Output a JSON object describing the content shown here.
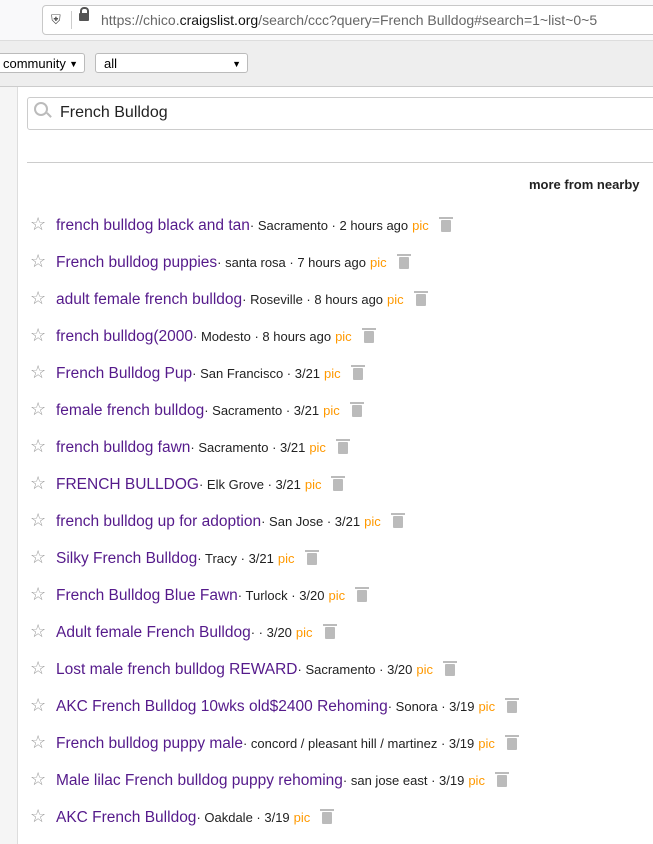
{
  "browser": {
    "url_prefix": "https://chico.",
    "url_domain": "craigslist.org",
    "url_suffix": "/search/ccc?query=French Bulldog#search=1~list~0~5"
  },
  "filters": {
    "category": "community",
    "subcategory": "all"
  },
  "search": {
    "query": "French Bulldog"
  },
  "nearby_label": "more from nearby",
  "results": [
    {
      "title": "french bulldog black and tan",
      "meta": " · Sacramento · 2 hours ago",
      "pic": "pic"
    },
    {
      "title": "French bulldog puppies",
      "meta": " · santa rosa · 7 hours ago",
      "pic": "pic"
    },
    {
      "title": "adult female french bulldog",
      "meta": " · Roseville · 8 hours ago",
      "pic": "pic"
    },
    {
      "title": "french bulldog(2000",
      "meta": " · Modesto · 8 hours ago",
      "pic": "pic"
    },
    {
      "title": "French Bulldog Pup",
      "meta": " · San Francisco · 3/21",
      "pic": "pic"
    },
    {
      "title": "female french bulldog",
      "meta": " · Sacramento · 3/21",
      "pic": "pic"
    },
    {
      "title": "french bulldog fawn",
      "meta": " · Sacramento · 3/21",
      "pic": "pic"
    },
    {
      "title": "FRENCH BULLDOG",
      "meta": " · Elk Grove · 3/21",
      "pic": "pic"
    },
    {
      "title": "french bulldog up for adoption",
      "meta": " · San Jose · 3/21",
      "pic": "pic"
    },
    {
      "title": "Silky French Bulldog",
      "meta": " · Tracy · 3/21",
      "pic": "pic"
    },
    {
      "title": "French Bulldog Blue Fawn",
      "meta": " · Turlock · 3/20",
      "pic": "pic"
    },
    {
      "title": "Adult female French Bulldog",
      "meta": " ·  · 3/20",
      "pic": "pic"
    },
    {
      "title": "Lost male french bulldog REWARD",
      "meta": " · Sacramento · 3/20",
      "pic": "pic"
    },
    {
      "title": "AKC French Bulldog 10wks old$2400 Rehoming",
      "meta": " · Sonora · 3/19",
      "pic": "pic"
    },
    {
      "title": "French bulldog puppy male",
      "meta": " · concord / pleasant hill / martinez · 3/19",
      "pic": "pic"
    },
    {
      "title": "Male lilac French bulldog puppy rehoming",
      "meta": " · san jose east · 3/19",
      "pic": "pic"
    },
    {
      "title": "AKC French Bulldog",
      "meta": " · Oakdale · 3/19",
      "pic": "pic"
    }
  ],
  "colors": {
    "visited_link": "#551a8b",
    "pic": "#ff9900"
  }
}
